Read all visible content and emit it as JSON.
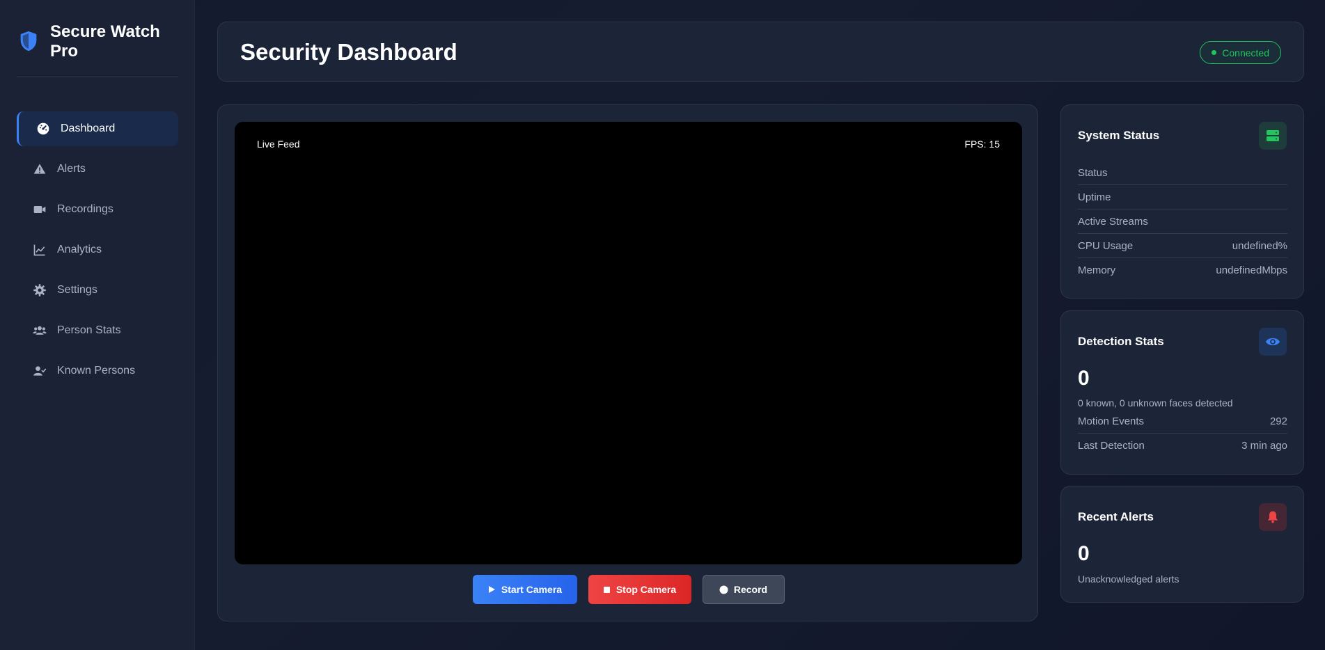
{
  "brand": {
    "title": "Secure Watch Pro"
  },
  "sidebar": {
    "items": [
      {
        "label": "Dashboard",
        "icon": "gauge-icon",
        "active": true
      },
      {
        "label": "Alerts",
        "icon": "warning-icon"
      },
      {
        "label": "Recordings",
        "icon": "video-icon"
      },
      {
        "label": "Analytics",
        "icon": "chart-line-icon"
      },
      {
        "label": "Settings",
        "icon": "gear-icon"
      },
      {
        "label": "Person Stats",
        "icon": "users-icon"
      },
      {
        "label": "Known Persons",
        "icon": "user-check-icon"
      }
    ]
  },
  "header": {
    "title": "Security Dashboard",
    "connection_status": "Connected"
  },
  "video": {
    "feed_label": "Live Feed",
    "fps_label": "FPS: 15",
    "buttons": {
      "start": "Start Camera",
      "stop": "Stop Camera",
      "record": "Record"
    }
  },
  "system_status": {
    "title": "System Status",
    "rows": [
      {
        "label": "Status",
        "value": ""
      },
      {
        "label": "Uptime",
        "value": ""
      },
      {
        "label": "Active Streams",
        "value": ""
      },
      {
        "label": "CPU Usage",
        "value": "undefined%"
      },
      {
        "label": "Memory",
        "value": "undefinedMbps"
      }
    ]
  },
  "detection_stats": {
    "title": "Detection Stats",
    "count": "0",
    "description": "0 known, 0 unknown faces detected",
    "rows": [
      {
        "label": "Motion Events",
        "value": "292"
      },
      {
        "label": "Last Detection",
        "value": "3 min ago"
      }
    ]
  },
  "recent_alerts": {
    "title": "Recent Alerts",
    "count": "0",
    "description": "Unacknowledged alerts"
  },
  "colors": {
    "accent": "#3b82f6",
    "success": "#22c55e",
    "danger": "#ef4444"
  }
}
